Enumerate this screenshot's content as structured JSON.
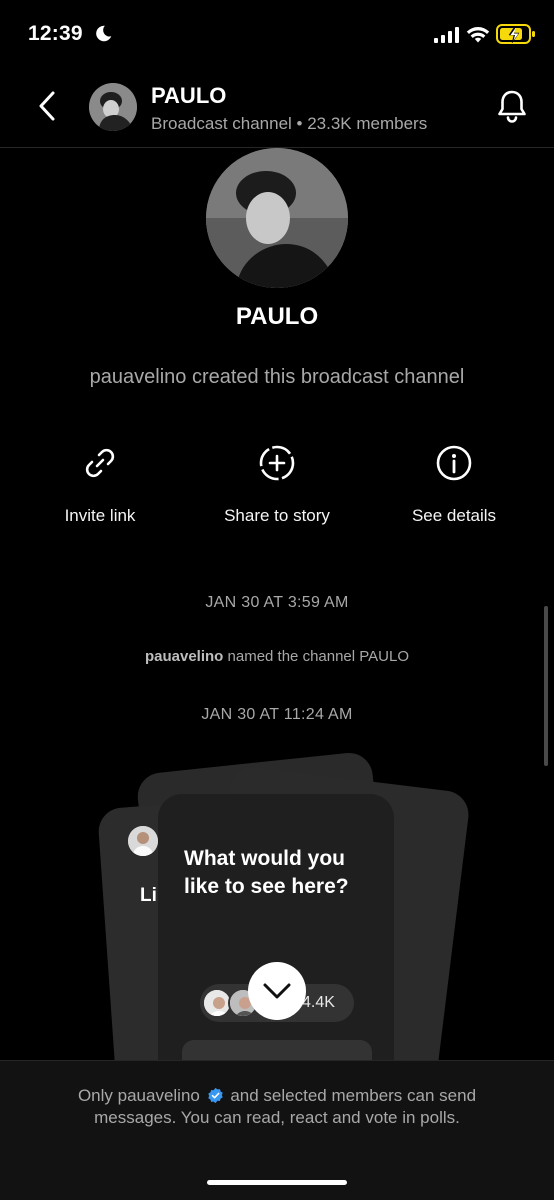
{
  "status_bar": {
    "time": "12:39",
    "battery_color": "#f5d90a"
  },
  "header": {
    "title": "PAULO",
    "subtitle": "Broadcast channel • 23.3K members"
  },
  "profile": {
    "name": "PAULO",
    "created_text": "pauavelino created this broadcast channel"
  },
  "actions": [
    {
      "label": "Invite link",
      "icon": "link-icon"
    },
    {
      "label": "Share to story",
      "icon": "add-story-icon"
    },
    {
      "label": "See details",
      "icon": "info-icon"
    }
  ],
  "timeline": {
    "date1": "JAN 30 AT 3:59 AM",
    "named_user": "pauavelino",
    "named_rest": " named the channel PAULO",
    "date2": "JAN 30 AT 11:24 AM"
  },
  "cards": {
    "left_card_text": "Li",
    "front_question": "What would you like to see here?",
    "vote_count": "4.4K"
  },
  "footer": {
    "before": "Only pauavelino",
    "after": " and selected members can send messages. You can read, react and vote in polls."
  },
  "colors": {
    "background": "#000000",
    "muted_text": "#a8a8a8",
    "verified": "#3897f0"
  }
}
